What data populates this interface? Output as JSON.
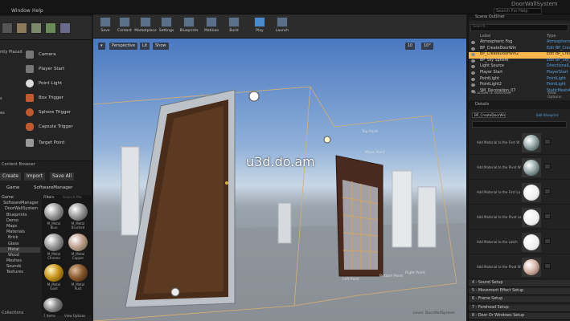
{
  "titlebar": {
    "menu": [
      "Window",
      "Help"
    ],
    "title": "DoorWallSystem",
    "search_placeholder": "Search For Help"
  },
  "place_panel": {
    "categories": [
      "ntly Placed",
      "s",
      "es"
    ],
    "items": [
      "Camera",
      "Player Start",
      "Point Light",
      "Box Trigger",
      "Sphere Trigger",
      "Capsule Trigger",
      "Target Point"
    ]
  },
  "toolbar": {
    "buttons": [
      "Save",
      "Content",
      "Marketplace",
      "Settings",
      "Blueprints",
      "Matinee",
      "Build",
      "Play",
      "Launch"
    ]
  },
  "viewport": {
    "perspective": "Perspective",
    "lit": "Lit",
    "show": "Show",
    "grid_snap": "10",
    "rot_snap": "10°",
    "watermark": "u3d.do.am",
    "labels": {
      "top_point": "Top Point",
      "move_point": "Move Point",
      "bottom_point": "Bottom Point",
      "left_point": "Left Point",
      "right_point": "Right Point"
    },
    "level_label": "Level: DoorWallSystem"
  },
  "content_browser": {
    "tab": "Content Browser",
    "create": "Create",
    "import": "Import",
    "save_all": "Save All",
    "breadcrumb": [
      "Game",
      "SoftwareManager"
    ],
    "filters": "Filters",
    "search_placeholder": "Search Ma",
    "tree": [
      "Game",
      "SoftwareManager",
      "DoorWallSystem",
      "Blueprints",
      "Demo",
      "Maps",
      "Materials",
      "Brick",
      "Glass",
      "Metal",
      "Wood",
      "Meshes",
      "Sounds",
      "Textures"
    ],
    "assets": [
      "M_Metal Blue",
      "M_Metal Brushed",
      "M_Metal Chrome",
      "M_Metal Copper",
      "M_Metal Gold",
      "M_Metal Rust"
    ],
    "item_count": "7 items",
    "view_options": "View Options",
    "collections": "Collections"
  },
  "outliner": {
    "tab": "Scene Outliner",
    "search_placeholder": "Search...",
    "col_label": "Label",
    "col_type": "Type",
    "rows": [
      {
        "label": "Atmospheric Fog",
        "type": "AtmosphericFog",
        "selected": false
      },
      {
        "label": "BP_CreateDoorWin",
        "type": "Edit BP_CreateDoorWin",
        "selected": false
      },
      {
        "label": "BP_CreateDoorWin2",
        "type": "Edit BP_CreateDoorWin",
        "selected": true
      },
      {
        "label": "BP_Sky Sphere",
        "type": "Edit BP_Sky_Sphere",
        "selected": false
      },
      {
        "label": "Light Source",
        "type": "DirectionalLight",
        "selected": false
      },
      {
        "label": "Player Start",
        "type": "PlayerStart",
        "selected": false
      },
      {
        "label": "PointLight",
        "type": "PointLight",
        "selected": false
      },
      {
        "label": "PointLight2",
        "type": "PointLight",
        "selected": false
      },
      {
        "label": "SM_Decoration_07",
        "type": "StaticMeshActor",
        "selected": false
      }
    ],
    "status": "9 actors (1 selected)",
    "view_options": "View Options"
  },
  "details": {
    "tab": "Details",
    "object_name": "BP_CreateDoorWin2",
    "edit_blueprint": "Edit Blueprint",
    "rows": [
      {
        "label": "Add Material to the First W",
        "sphere": "metal"
      },
      {
        "label": "Add Material to the Pivot W",
        "sphere": "metal"
      },
      {
        "label": "Add Material to the First La",
        "sphere": "white"
      },
      {
        "label": "Add Material to the Pivot La",
        "sphere": "white"
      },
      {
        "label": "Add Material to the Latch",
        "sphere": "white"
      },
      {
        "label": "Add Material to the Pivot W",
        "sphere": "pink"
      }
    ],
    "sections": [
      "4 - Sound Setup",
      "5 - Movement Effect Setup",
      "6 - Frame Setup",
      "7 - Forehead Setup",
      "8 - Door Or Windows Setup"
    ]
  },
  "colors": {
    "selection": "#ffb84d",
    "type_link": "#5aa0e0"
  }
}
